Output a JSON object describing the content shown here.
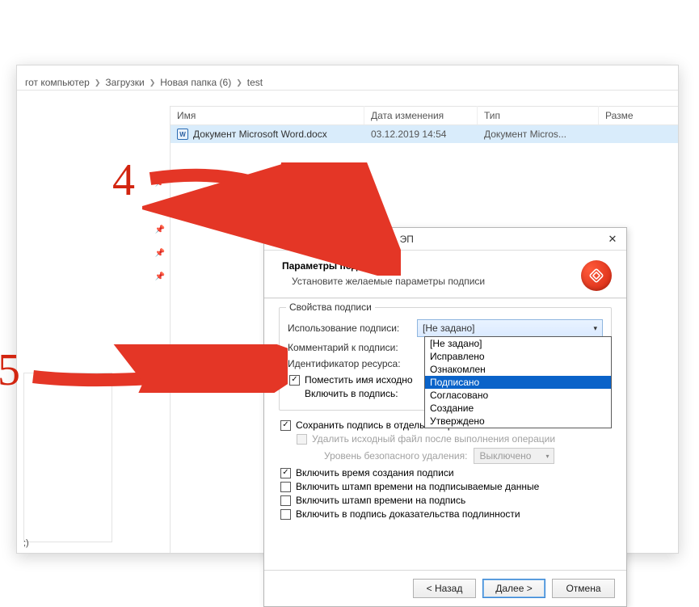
{
  "breadcrumb": {
    "seg0": "гот компьютер",
    "seg1": "Загрузки",
    "seg2": "Новая папка (6)",
    "seg3": "test"
  },
  "columns": {
    "name": "Имя",
    "date": "Дата изменения",
    "type": "Тип",
    "size": "Разме"
  },
  "file": {
    "name": "Документ Microsoft Word.docx",
    "date": "03.12.2019 14:54",
    "type": "Документ Micros..."
  },
  "sidebar_footer": ";)",
  "dialog": {
    "title": "КриптоАРМ :: Создание ЭП",
    "heading": "Параметры подписи",
    "subheading": "Установите желаемые параметры подписи",
    "group_legend": "Свойства подписи",
    "use_label": "Использование подписи:",
    "use_value": "[Не задано]",
    "comment_label": "Комментарий к подписи:",
    "resource_label": "Идентификатор ресурса:",
    "chk_put_name": "Поместить имя исходно",
    "chk_include": "Включить в подпись:",
    "chk_save_separate": "Сохранить подпись в отдельном файле",
    "chk_delete_src": "Удалить исходный файл после выполнения операции",
    "secure_delete_label": "Уровень безопасного удаления:",
    "secure_delete_value": "Выключено",
    "chk_time_creation": "Включить время создания подписи",
    "chk_stamp_data": "Включить штамп времени на подписываемые данные",
    "chk_stamp_sign": "Включить штамп времени на подпись",
    "chk_evidence": "Включить в подпись доказательства подлинности",
    "btn_back": "< Назад",
    "btn_next": "Далее >",
    "btn_cancel": "Отмена"
  },
  "dropdown_options": [
    "[Не задано]",
    "Исправлено",
    "Ознакомлен",
    "Подписано",
    "Согласовано",
    "Создание",
    "Утверждено"
  ],
  "annotations": {
    "n4": "4",
    "n5": "5"
  }
}
